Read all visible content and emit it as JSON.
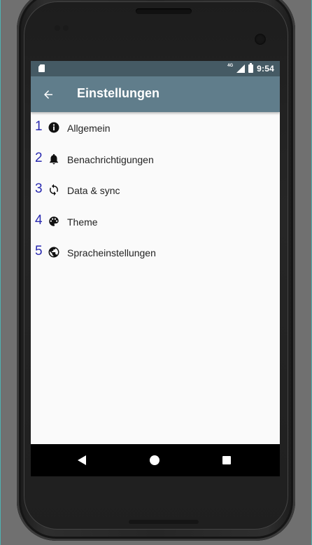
{
  "statusbar": {
    "network": "4G",
    "time": "9:54"
  },
  "appbar": {
    "title": "Einstellungen",
    "back_icon": "arrow-left-icon"
  },
  "settings": {
    "items": [
      {
        "number": "1",
        "icon": "info-icon",
        "label": "Allgemein"
      },
      {
        "number": "2",
        "icon": "bell-icon",
        "label": "Benachrichtigungen"
      },
      {
        "number": "3",
        "icon": "sync-icon",
        "label": "Data & sync"
      },
      {
        "number": "4",
        "icon": "palette-icon",
        "label": "Theme"
      },
      {
        "number": "5",
        "icon": "globe-icon",
        "label": "Spracheinstellungen"
      }
    ]
  },
  "navbar": {
    "back_icon": "triangle-back-icon",
    "home_icon": "circle-home-icon",
    "recents_icon": "square-recents-icon"
  },
  "colors": {
    "statusbar": "#455a64",
    "appbar": "#607d8b",
    "number_accent": "#2b2bb0",
    "screen_background": "#fafafa"
  }
}
